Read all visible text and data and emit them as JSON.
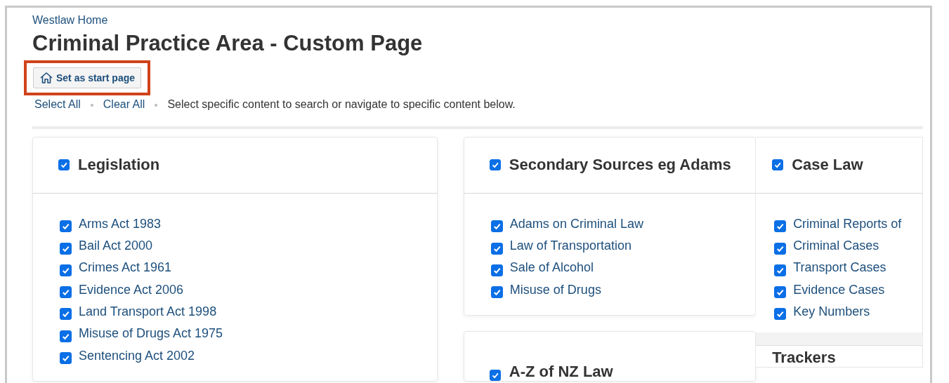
{
  "breadcrumb": "Westlaw Home",
  "title": "Criminal Practice Area - Custom Page",
  "start_page_button": {
    "label": "Set as start page",
    "highlighted": true
  },
  "actions": [
    {
      "label": "Select All"
    },
    {
      "label": "Clear All"
    }
  ],
  "instruction": "Select specific content to search or navigate to specific content below.",
  "columns": [
    [
      {
        "title": "Legislation",
        "checked": true,
        "items": [
          {
            "label": "Arms Act 1983",
            "checked": true
          },
          {
            "label": "Bail Act 2000",
            "checked": true
          },
          {
            "label": "Crimes Act 1961",
            "checked": true
          },
          {
            "label": "Evidence Act 2006",
            "checked": true
          },
          {
            "label": "Land Transport Act 1998",
            "checked": true
          },
          {
            "label": "Misuse of Drugs Act 1975",
            "checked": true
          },
          {
            "label": "Sentencing Act 2002",
            "checked": true
          }
        ]
      }
    ],
    [
      {
        "title": "Secondary Sources eg Adams",
        "checked": true,
        "items": [
          {
            "label": "Adams on Criminal Law",
            "checked": true
          },
          {
            "label": "Law of Transportation",
            "checked": true
          },
          {
            "label": "Sale of Alcohol",
            "checked": true
          },
          {
            "label": "Misuse of Drugs",
            "checked": true
          }
        ]
      },
      {
        "title": "A-Z of NZ Law",
        "checked": true
      }
    ],
    [
      {
        "title": "Case Law",
        "checked": true,
        "items": [
          {
            "label": "Criminal Reports of",
            "checked": true
          },
          {
            "label": "Criminal Cases",
            "checked": true
          },
          {
            "label": "Transport Cases",
            "checked": true
          },
          {
            "label": "Evidence Cases",
            "checked": true
          },
          {
            "label": "Key Numbers",
            "checked": true
          }
        ]
      },
      {
        "title": "Trackers"
      }
    ]
  ]
}
